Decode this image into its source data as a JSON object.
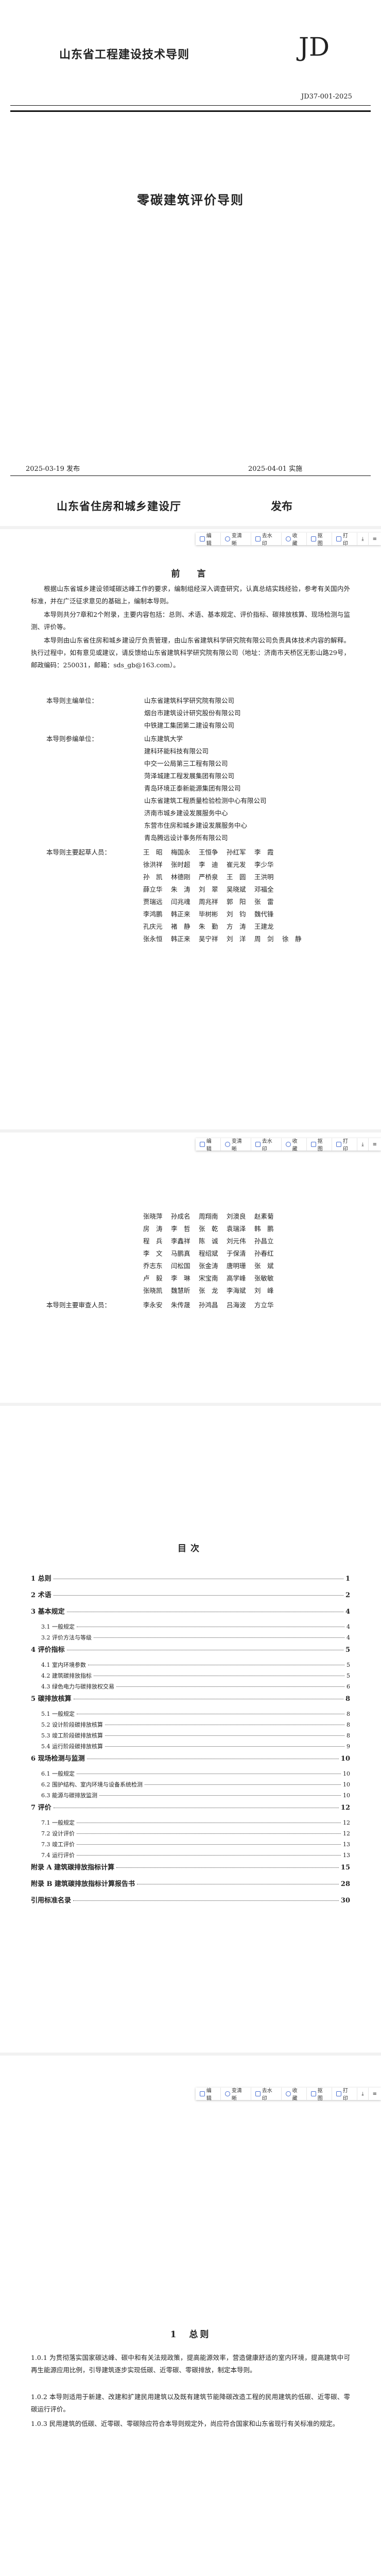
{
  "cover": {
    "title": "山东省工程建设技术导则",
    "mark": "JD",
    "std_number": "JD37-001-2025",
    "doc_title": "零碳建筑评价导则",
    "publish_date": "2025-03-19 发布",
    "effective_date": "2025-04-01 实施",
    "issuer": "山东省住房和城乡建设厅",
    "issue_word": "发布"
  },
  "toolbar": {
    "edit": "编辑",
    "bend": "变清晰",
    "watermark": "去水印",
    "fav": "收藏",
    "crop": "抠图",
    "print": "打印"
  },
  "preface": {
    "title": "前　言",
    "paragraphs": [
      "根据山东省城乡建设领域碳达峰工作的要求，编制组经深入调查研究，认真总结实践经验，参考有关国内外标准，并在广泛征求意见的基础上，编制本导则。",
      "本导则共分7章和2个附录，主要内容包括：总则、术语、基本规定、评价指标、碳排放核算、现场检测与监测、评价等。",
      "本导则由山东省住房和城乡建设厅负责管理，由山东省建筑科学研究院有限公司负责具体技术内容的解释。执行过程中，如有意见或建议，请反馈给山东省建筑科学研究院有限公司（地址：济南市天桥区无影山路29号，邮政编码：250031，邮箱：sds_gb@163.com）。"
    ],
    "chief_label": "本导则主编单位：",
    "chief_orgs": [
      "山东省建筑科学研究院有限公司",
      "烟台市建筑设计研究股份有限公司",
      "中铁建工集团第二建设有限公司"
    ],
    "co_label": "本导则参编单位：",
    "co_orgs": [
      "山东建筑大学",
      "建科环能科技有限公司",
      "中交一公局第三工程有限公司",
      "菏泽城建工程发展集团有限公司",
      "青岛环境正泰新能源集团有限公司",
      "山东省建筑工程质量检验检测中心有限公司",
      "济南市城乡建设发展服务中心",
      "东营市住房和城乡建设发展服务中心",
      "青岛腾远设计事务所有限公司"
    ],
    "drafter_label": "本导则主要起草人员：",
    "drafters_page1": [
      [
        "王　昭",
        "梅国永",
        "王恒争",
        "孙红军",
        "李　霞"
      ],
      [
        "徐洪祥",
        "张时超",
        "李　迪",
        "崔元发",
        "李少华"
      ],
      [
        "孙　凯",
        "林德刚",
        "严桥泉",
        "王　圆",
        "王洪明"
      ],
      [
        "薛立华",
        "朱　涛",
        "刘　翠",
        "吴晓斌",
        "邓福全"
      ],
      [
        "贾瑞远",
        "闫兆魂",
        "周兆祥",
        "郭　阳",
        "张　雷"
      ],
      [
        "李鸿鹏",
        "韩正来",
        "毕树彬",
        "刘　钧",
        "魏代锋"
      ],
      [
        "孔庆元",
        "褚　静",
        "朱　勤",
        "方　涛",
        "王建龙"
      ],
      [
        "张永恒",
        "韩正来",
        "吴宁祥",
        "刘　洋",
        "周　剑",
        "徐　静"
      ]
    ],
    "drafters_page2": [
      [
        "张晓萍",
        "孙成名",
        "周翔南",
        "刘澳良",
        "赵素菊"
      ],
      [
        "房　涛",
        "李　哲",
        "张　乾",
        "袁瑞泽",
        "韩　鹏"
      ],
      [
        "程　兵",
        "李鑫祥",
        "陈　诚",
        "刘元伟",
        "孙昌立"
      ],
      [
        "李　文",
        "马鹏真",
        "程绍斌",
        "于保清",
        "孙春红"
      ],
      [
        "乔志东",
        "闫松国",
        "张金涛",
        "唐明珊",
        "张　斌"
      ],
      [
        "卢　毅",
        "李　琳",
        "宋宝南",
        "高学峰",
        "张敏敏"
      ],
      [
        "张晓凯",
        "魏慧昕",
        "张　龙",
        "李海斌",
        "刘　峰"
      ]
    ],
    "reviewer_label": "本导则主要审查人员：",
    "reviewers": [
      "李永安",
      "朱传晟",
      "孙鸿昌",
      "吕海波",
      "方立华"
    ]
  },
  "toc": {
    "title": "目次",
    "entries": [
      {
        "label": "1 总则",
        "page": "1",
        "level": 1
      },
      {
        "label": "2 术语",
        "page": "2",
        "level": 1
      },
      {
        "label": "3 基本规定",
        "page": "4",
        "level": 1
      },
      {
        "label": "3.1 一般规定",
        "page": "4",
        "level": 2
      },
      {
        "label": "3.2 评价方法与等级",
        "page": "4",
        "level": 2
      },
      {
        "label": "4 评价指标",
        "page": "5",
        "level": 1
      },
      {
        "label": "4.1 室内环境参数",
        "page": "5",
        "level": 2
      },
      {
        "label": "4.2 建筑碳排放指标",
        "page": "5",
        "level": 2
      },
      {
        "label": "4.3 绿色电力与碳排放权交易",
        "page": "6",
        "level": 2
      },
      {
        "label": "5 碳排放核算",
        "page": "8",
        "level": 1
      },
      {
        "label": "5.1 一般规定",
        "page": "8",
        "level": 2
      },
      {
        "label": "5.2 设计阶段碳排放核算",
        "page": "8",
        "level": 2
      },
      {
        "label": "5.3 竣工阶段碳排放核算",
        "page": "8",
        "level": 2
      },
      {
        "label": "5.4 运行阶段碳排放核算",
        "page": "9",
        "level": 2
      },
      {
        "label": "6 现场检测与监测",
        "page": "10",
        "level": 1
      },
      {
        "label": "6.1 一般规定",
        "page": "10",
        "level": 2
      },
      {
        "label": "6.2 围护结构、室内环境与设备系统检测",
        "page": "10",
        "level": 2
      },
      {
        "label": "6.3 能源与碳排放监测",
        "page": "10",
        "level": 2
      },
      {
        "label": "7 评价",
        "page": "12",
        "level": 1
      },
      {
        "label": "7.1 一般规定",
        "page": "12",
        "level": 2
      },
      {
        "label": "7.2 设计评价",
        "page": "12",
        "level": 2
      },
      {
        "label": "7.3 竣工评价",
        "page": "13",
        "level": 2
      },
      {
        "label": "7.4 运行评价",
        "page": "13",
        "level": 2
      },
      {
        "label": "附录 A 建筑碳排放指标计算",
        "page": "15",
        "level": 1
      },
      {
        "label": "附录 B 建筑碳排放指标计算报告书",
        "page": "28",
        "level": 1
      },
      {
        "label": "引用标准名录",
        "page": "30",
        "level": 1
      }
    ]
  },
  "chapter1": {
    "title": "1　总则",
    "clauses": [
      "1.0.1 为贯彻落实国家碳达峰、碳中和有关法规政策，提高能源效率，营造健康舒适的室内环境，提高建筑中可再生能源应用比例，引导建筑逐步实现低碳、近零碳、零碳排放，制定本导则。",
      "1.0.2 本导则适用于新建、改建和扩建民用建筑以及既有建筑节能降碳改造工程的民用建筑的低碳、近零碳、零碳运行评价。",
      "1.0.3 民用建筑的低碳、近零碳、零碳除应符合本导则规定外，尚应符合国家和山东省现行有关标准的规定。"
    ]
  }
}
